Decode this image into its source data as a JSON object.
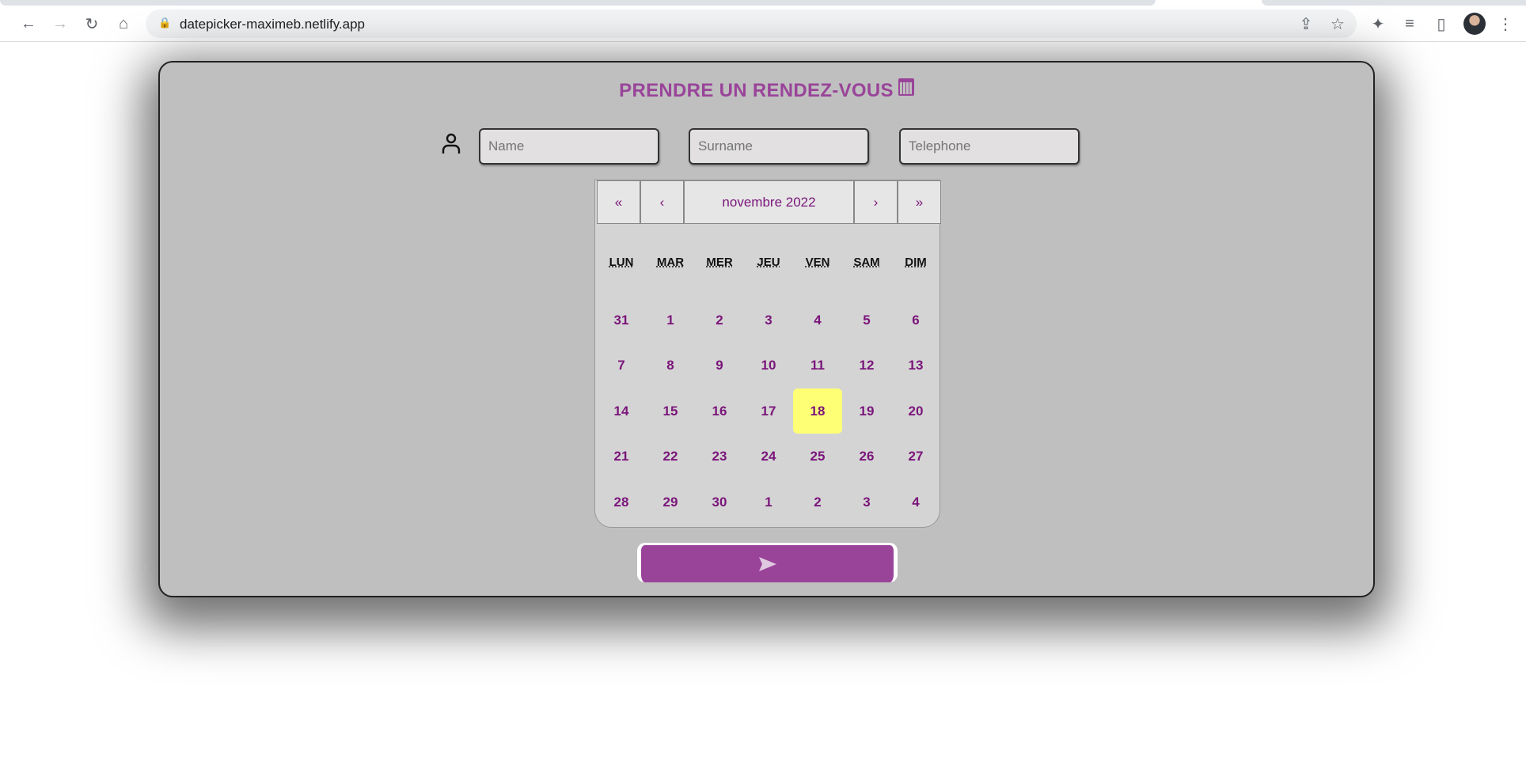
{
  "browser": {
    "url": "datepicker-maximeb.netlify.app"
  },
  "page": {
    "title": "PRENDRE UN RENDEZ-VOUS"
  },
  "form": {
    "name_placeholder": "Name",
    "surname_placeholder": "Surname",
    "telephone_placeholder": "Telephone"
  },
  "calendar": {
    "nav": {
      "prev_year": "«",
      "prev_month": "‹",
      "label": "novembre 2022",
      "next_month": "›",
      "next_year": "»"
    },
    "weekdays": [
      "LUN",
      "MAR",
      "MER",
      "JEU",
      "VEN",
      "SAM",
      "DIM"
    ],
    "weeks": [
      [
        "31",
        "1",
        "2",
        "3",
        "4",
        "5",
        "6"
      ],
      [
        "7",
        "8",
        "9",
        "10",
        "11",
        "12",
        "13"
      ],
      [
        "14",
        "15",
        "16",
        "17",
        "18",
        "19",
        "20"
      ],
      [
        "21",
        "22",
        "23",
        "24",
        "25",
        "26",
        "27"
      ],
      [
        "28",
        "29",
        "30",
        "1",
        "2",
        "3",
        "4"
      ]
    ],
    "selected": "18"
  },
  "colors": {
    "accent": "#994499",
    "selected_day": "#ffff76",
    "day_text": "#7a157a"
  }
}
